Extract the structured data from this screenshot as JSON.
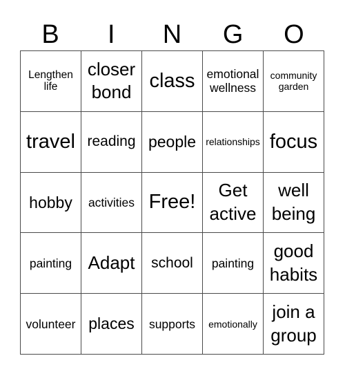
{
  "header": {
    "letters": [
      "B",
      "I",
      "N",
      "G",
      "O"
    ]
  },
  "board": {
    "rows": [
      [
        "Lengthen life",
        "closer bond",
        "class",
        "emotional wellness",
        "community garden"
      ],
      [
        "travel",
        "reading",
        "people",
        "relationships",
        "focus"
      ],
      [
        "hobby",
        "activities",
        "Free!",
        "Get active",
        "well being"
      ],
      [
        "painting",
        "Adapt",
        "school",
        "painting",
        "good habits"
      ],
      [
        "volunteer",
        "places",
        "supports",
        "emotionally",
        "join a group"
      ]
    ]
  },
  "colors": {
    "grid_line": "#4a4a4a",
    "background": "#ffffff",
    "text": "#000000"
  }
}
